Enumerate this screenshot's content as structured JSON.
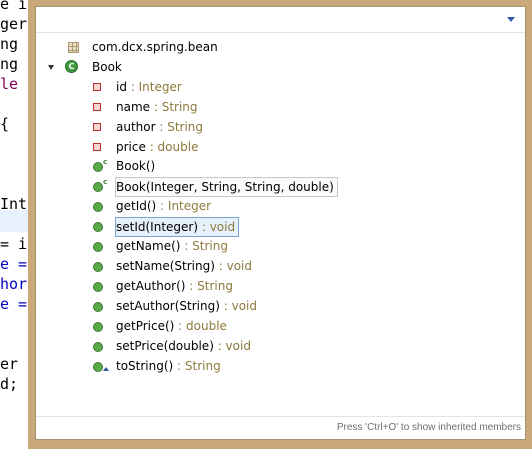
{
  "editor_fragments": [
    {
      "text": "e i",
      "color": "#000000"
    },
    {
      "text": "ger",
      "color": "#000000"
    },
    {
      "text": "ng n",
      "color": "#000000"
    },
    {
      "text": "ng a",
      "color": "#000000"
    },
    {
      "text": "le p",
      "color": "#7f0055"
    },
    {
      "text": "",
      "color": "#000000"
    },
    {
      "text": "{",
      "color": "#000000"
    },
    {
      "text": "",
      "color": "#000000"
    },
    {
      "text": "",
      "color": "#000000"
    },
    {
      "text": "",
      "color": "#000000"
    },
    {
      "text": "Inte",
      "color": "#000000"
    },
    {
      "text": "",
      "color": "#000000"
    },
    {
      "text": "= id",
      "color": "#000000"
    },
    {
      "text": "e =",
      "color": "#0000c0"
    },
    {
      "text": "hor",
      "color": "#0000c0"
    },
    {
      "text": "e =",
      "color": "#0000c0"
    },
    {
      "text": "",
      "color": "#000000"
    },
    {
      "text": "",
      "color": "#000000"
    },
    {
      "text": "er g",
      "color": "#000000"
    },
    {
      "text": "d;",
      "color": "#000000"
    }
  ],
  "outline": {
    "filter_value": "",
    "package": {
      "name": "com.dcx.spring.bean",
      "icon": "package-icon"
    },
    "class": {
      "name": "Book",
      "icon": "class-icon",
      "icon_letter": "C",
      "expanded": true
    },
    "fields": [
      {
        "name": "id",
        "type": " : Integer"
      },
      {
        "name": "name",
        "type": " : String"
      },
      {
        "name": "author",
        "type": " : String"
      },
      {
        "name": "price",
        "type": " : double"
      }
    ],
    "methods": [
      {
        "name": "Book()",
        "type": "",
        "marker": "constructor",
        "marker_text": "c"
      },
      {
        "name": "Book(Integer, String, String, double)",
        "type": "",
        "marker": "constructor",
        "marker_text": "c",
        "boxed": true
      },
      {
        "name": "getId()",
        "type": " : Integer"
      },
      {
        "name": "setId(Integer)",
        "type": " : void",
        "selected": true
      },
      {
        "name": "getName()",
        "type": " : String"
      },
      {
        "name": "setName(String)",
        "type": " : void"
      },
      {
        "name": "getAuthor()",
        "type": " : String"
      },
      {
        "name": "setAuthor(String)",
        "type": " : void"
      },
      {
        "name": "getPrice()",
        "type": " : double"
      },
      {
        "name": "setPrice(double)",
        "type": " : void"
      },
      {
        "name": "toString()",
        "type": " : String",
        "marker": "override"
      }
    ],
    "status_text": "Press 'Ctrl+O' to show inherited members"
  },
  "colors": {
    "frame": "#c9a97c",
    "type_text": "#8e7a3c",
    "selection_bg": "#e6f0fa",
    "field_icon": "#c0322b",
    "method_icon": "#5aaa4a"
  }
}
